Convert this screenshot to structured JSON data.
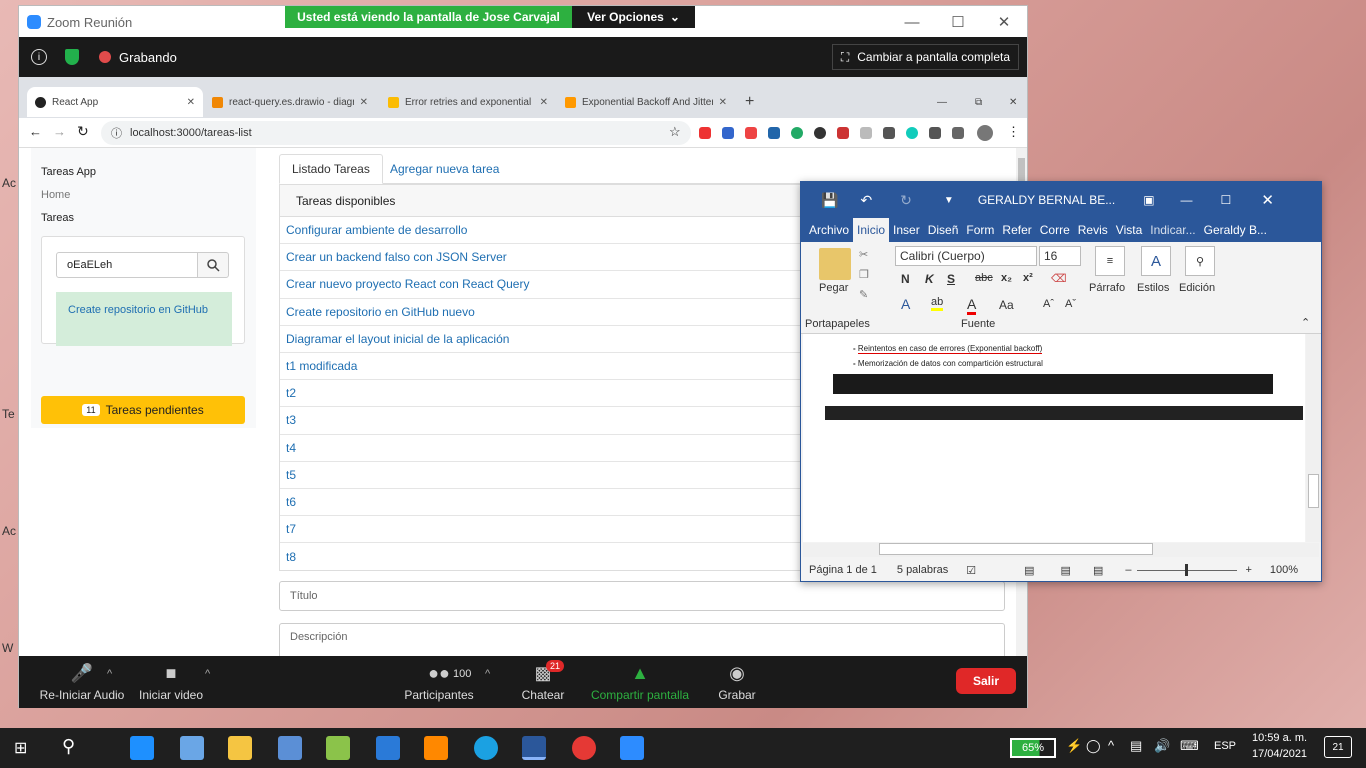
{
  "desktop": {
    "labels": [
      "Ac",
      "Te",
      "Ac",
      "W"
    ]
  },
  "zoom": {
    "window_title": "Zoom Reunión",
    "share_banner": "Usted está viendo la pantalla de Jose Carvajal",
    "view_options": "Ver Opciones",
    "recording": "Grabando",
    "fullscreen": "Cambiar a pantalla completa",
    "controls": {
      "audio": "Re-Iniciar Audio",
      "video": "Iniciar video",
      "participants_count": "100",
      "participants": "Participantes",
      "chat": "Chatear",
      "chat_badge": "21",
      "share": "Compartir pantalla",
      "record": "Grabar",
      "leave": "Salir"
    }
  },
  "browser": {
    "tabs": [
      {
        "title": "React App"
      },
      {
        "title": "react-query.es.drawio - diagrams"
      },
      {
        "title": "Error retries and exponential back"
      },
      {
        "title": "Exponential Backoff And Jitter | AWS"
      }
    ],
    "url": "localhost:3000/tareas-list"
  },
  "app": {
    "brand": "Tareas App",
    "nav": [
      "Home",
      "Tareas"
    ],
    "search_value": "oEaELeh",
    "create_link": "Create repositorio en GitHub",
    "pending_count": "11",
    "pending_label": "Tareas pendientes",
    "tabs": [
      "Listado Tareas",
      "Agregar nueva tarea"
    ],
    "list_header": "Tareas disponibles",
    "tasks": [
      "Configurar ambiente de desarrollo",
      "Crear un backend falso con JSON Server",
      "Crear nuevo proyecto React con React Query",
      "Create repositorio en GitHub nuevo",
      "Diagramar el layout inicial de la aplicación",
      "t1 modificada",
      "t2",
      "t3",
      "t4",
      "t5",
      "t6",
      "t7",
      "t8"
    ],
    "title_placeholder": "Título",
    "description_placeholder": "Descripción"
  },
  "word": {
    "title": "GERALDY BERNAL BE...",
    "tabs": [
      "Archivo",
      "Inicio",
      "Inser",
      "Diseñ",
      "Form",
      "Refer",
      "Corre",
      "Revis",
      "Vista",
      "Indicar...",
      "Geraldy B..."
    ],
    "font": "Calibri (Cuerpo)",
    "size": "16",
    "paste": "Pegar",
    "paragraph": "Párrafo",
    "styles": "Estilos",
    "editing": "Edición",
    "group_clipboard": "Portapapeles",
    "group_font": "Fuente",
    "doc_lines": [
      "Reintentos en caso de errores (Exponential backoff)",
      "Memorización de datos con compartición estructural"
    ],
    "page_status": "Página 1 de 1",
    "words": "5 palabras",
    "zoom": "100%"
  },
  "taskbar": {
    "battery": "65%",
    "lang": "ESP",
    "time": "10:59 a. m.",
    "date": "17/04/2021",
    "notifications": "21"
  }
}
